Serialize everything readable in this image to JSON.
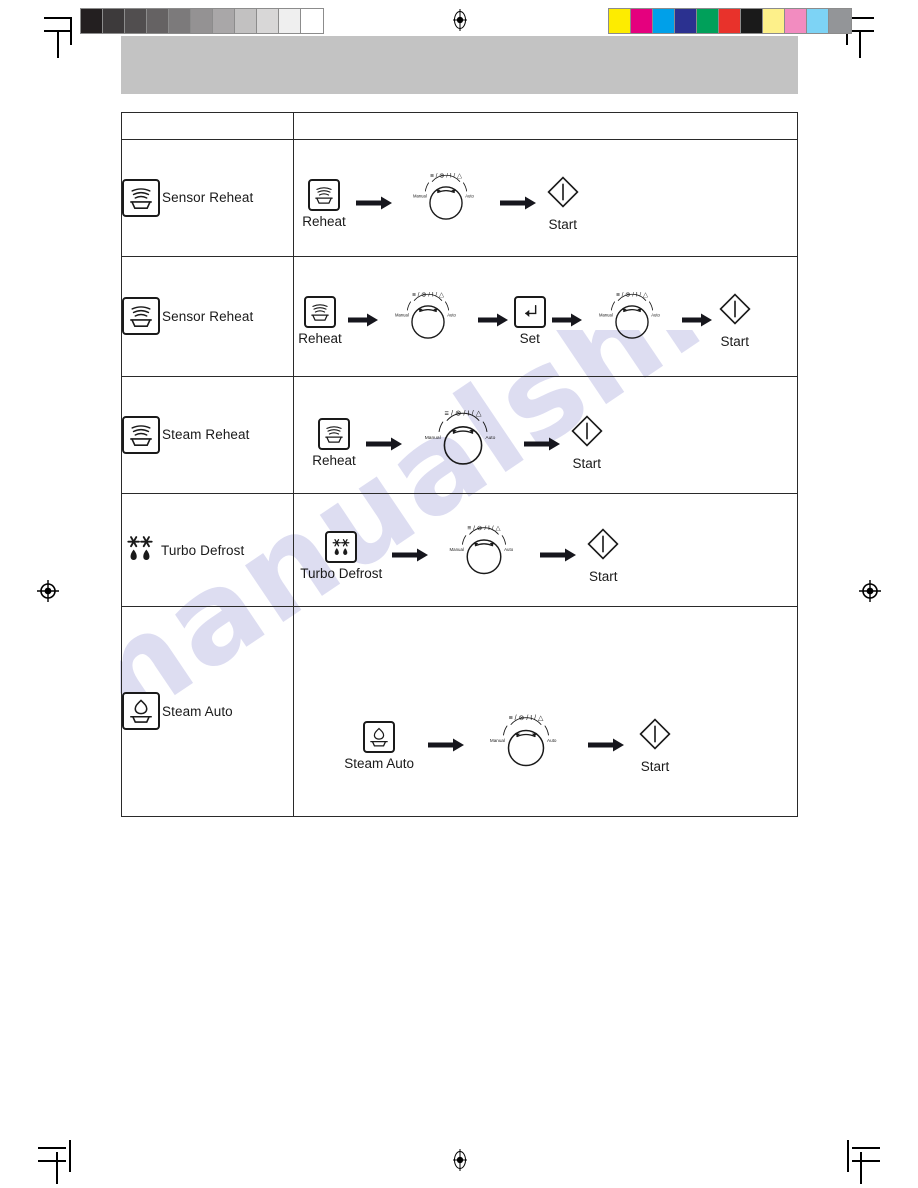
{
  "page": {
    "watermark_text": "manualshive.com",
    "banner_color": "#c3c3c3"
  },
  "calibration": {
    "grayscale_label": "grayscale-step-wedge",
    "grayscale_patches": [
      "#231f20",
      "#3d3a3b",
      "#514e4f",
      "#656263",
      "#7c7a7b",
      "#949293",
      "#a9a7a8",
      "#c2c1c1",
      "#d8d7d7",
      "#efefef",
      "#ffffff"
    ],
    "color_label": "color-control-patches",
    "color_patches": [
      "#fdec00",
      "#e5007e",
      "#00a0e9",
      "#2b3190",
      "#00a05a",
      "#e8322b",
      "#1a1a1a",
      "#fdf08a",
      "#f28cc0",
      "#7dd3f5",
      "#939598"
    ]
  },
  "table": {
    "header": {
      "col1": "",
      "col2": ""
    },
    "rows": [
      {
        "mode_label": "Sensor Reheat",
        "mode_icon": "sensor-reheat-icon",
        "steps": [
          {
            "type": "key",
            "icon": "reheat-key-icon",
            "label": "Reheat"
          },
          {
            "type": "arrow",
            "icon": "arrow-right-icon"
          },
          {
            "type": "dial",
            "icon": "selector-dial",
            "top_symbols": "≡ / ⊗ / I / △",
            "left_label": "Manual",
            "right_label": "Auto"
          },
          {
            "type": "arrow",
            "icon": "arrow-right-icon"
          },
          {
            "type": "key-diamond",
            "icon": "start-key-icon",
            "label": "Start"
          }
        ]
      },
      {
        "mode_label": "Sensor Reheat",
        "mode_icon": "sensor-reheat-icon",
        "steps": [
          {
            "type": "key",
            "icon": "reheat-key-icon",
            "label": "Reheat"
          },
          {
            "type": "arrow",
            "icon": "arrow-right-icon"
          },
          {
            "type": "dial",
            "icon": "selector-dial",
            "top_symbols": "≡ / ⊗ / I / △",
            "left_label": "Manual",
            "right_label": "Auto"
          },
          {
            "type": "arrow",
            "icon": "arrow-right-icon"
          },
          {
            "type": "key",
            "icon": "set-key-icon",
            "label": "Set"
          },
          {
            "type": "arrow",
            "icon": "arrow-right-icon"
          },
          {
            "type": "dial",
            "icon": "selector-dial",
            "top_symbols": "≡ / ⊗ / I / △",
            "left_label": "Manual",
            "right_label": "Auto"
          },
          {
            "type": "arrow",
            "icon": "arrow-right-icon"
          },
          {
            "type": "key-diamond",
            "icon": "start-key-icon",
            "label": "Start"
          }
        ]
      },
      {
        "mode_label": "Steam Reheat",
        "mode_icon": "steam-reheat-icon",
        "steps": [
          {
            "type": "key",
            "icon": "reheat-key-icon",
            "label": "Reheat"
          },
          {
            "type": "arrow",
            "icon": "arrow-right-icon"
          },
          {
            "type": "dial",
            "icon": "selector-dial",
            "top_symbols": "≡ / ⊗ / I / △",
            "left_label": "Manual",
            "right_label": "Auto"
          },
          {
            "type": "arrow",
            "icon": "arrow-right-icon"
          },
          {
            "type": "key-diamond",
            "icon": "start-key-icon",
            "label": "Start"
          }
        ]
      },
      {
        "mode_label": "Turbo Defrost",
        "mode_icon": "turbo-defrost-symbol",
        "steps": [
          {
            "type": "key",
            "icon": "turbo-defrost-key-icon",
            "label": "Turbo Defrost"
          },
          {
            "type": "arrow",
            "icon": "arrow-right-icon"
          },
          {
            "type": "dial",
            "icon": "selector-dial",
            "top_symbols": "≡ / ⊗ / I / △",
            "left_label": "Manual",
            "right_label": "Auto"
          },
          {
            "type": "arrow",
            "icon": "arrow-right-icon"
          },
          {
            "type": "key-diamond",
            "icon": "start-key-icon",
            "label": "Start"
          }
        ]
      },
      {
        "mode_label": "Steam Auto",
        "mode_icon": "steam-auto-icon",
        "steps": [
          {
            "type": "key",
            "icon": "steam-auto-key-icon",
            "label": "Steam Auto"
          },
          {
            "type": "arrow",
            "icon": "arrow-right-icon"
          },
          {
            "type": "dial",
            "icon": "selector-dial",
            "top_symbols": "≡ / ⊗ / I / △",
            "left_label": "Manual",
            "right_label": "Auto"
          },
          {
            "type": "arrow",
            "icon": "arrow-right-icon"
          },
          {
            "type": "key-diamond",
            "icon": "start-key-icon",
            "label": "Start"
          }
        ]
      }
    ]
  }
}
